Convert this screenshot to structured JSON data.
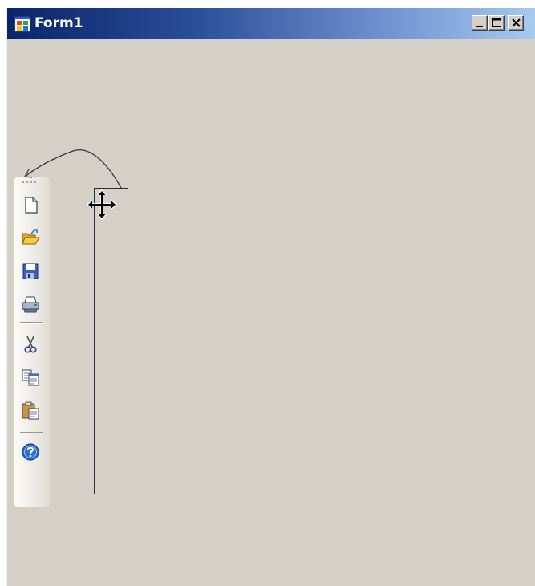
{
  "window": {
    "title": "Form1",
    "app_icon": "form-icon",
    "controls": {
      "minimize_icon": "minimize-icon",
      "maximize_icon": "maximize-icon",
      "close_icon": "close-icon"
    }
  },
  "toolstrip": {
    "orientation": "vertical",
    "items": [
      {
        "icon": "new-document-icon",
        "label": ""
      },
      {
        "icon": "open-folder-icon",
        "label": ""
      },
      {
        "icon": "save-disk-icon",
        "label": ""
      },
      {
        "icon": "print-icon",
        "label": ""
      },
      {
        "icon": "separator",
        "label": ""
      },
      {
        "icon": "cut-scissors-icon",
        "label": ""
      },
      {
        "icon": "copy-icon",
        "label": ""
      },
      {
        "icon": "paste-clipboard-icon",
        "label": ""
      },
      {
        "icon": "separator",
        "label": ""
      },
      {
        "icon": "help-icon",
        "label": ""
      }
    ]
  },
  "overlay": {
    "cursor": "move-cursor-icon",
    "drag_preview": "toolstrip-drag-outline",
    "annotation": "curved-arrow-icon"
  },
  "colors": {
    "form_background": "#d4d0c8",
    "titlebar_start": "#0a246a",
    "titlebar_end": "#a6caf0",
    "title_text": "#ffffff"
  }
}
